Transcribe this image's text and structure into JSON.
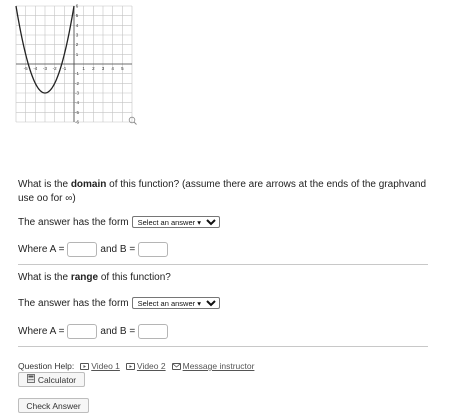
{
  "graph": {
    "x_ticks": [
      "-5",
      "-4",
      "-3",
      "-2",
      "-1",
      "1",
      "2",
      "3",
      "4",
      "5"
    ],
    "y_ticks_pos": [
      "6",
      "5",
      "4",
      "3",
      "2",
      "1"
    ],
    "y_ticks_neg": [
      "-1",
      "-2",
      "-3",
      "-4",
      "-5",
      "-6"
    ],
    "xlim": [
      -6,
      6
    ],
    "ylim": [
      -6,
      6
    ],
    "vertex": [
      -3,
      -3
    ],
    "curve_color": "#222222",
    "zoom_icon": "magnifier-icon"
  },
  "domain_q": {
    "prefix": "What is the ",
    "keyword": "domain",
    "suffix": " of this function? (assume there are arrows at the ends of the graphvand",
    "line2": "use oo for ∞)"
  },
  "domain_form": {
    "label": "The answer has the form",
    "select": "Select an answer ▾"
  },
  "domain_ab": {
    "where": "Where A =",
    "and": "and B ="
  },
  "range_q": {
    "prefix": "What is the ",
    "keyword": "range",
    "suffix": " of this function?"
  },
  "range_form": {
    "label": "The answer has the form",
    "select": "Select an answer ▾"
  },
  "range_ab": {
    "where": "Where A =",
    "and": "and B ="
  },
  "help": {
    "label": "Question Help:",
    "video1": "Video 1",
    "video2": "Video 2",
    "message": "Message instructor"
  },
  "buttons": {
    "calculator": "Calculator",
    "check": "Check Answer"
  }
}
